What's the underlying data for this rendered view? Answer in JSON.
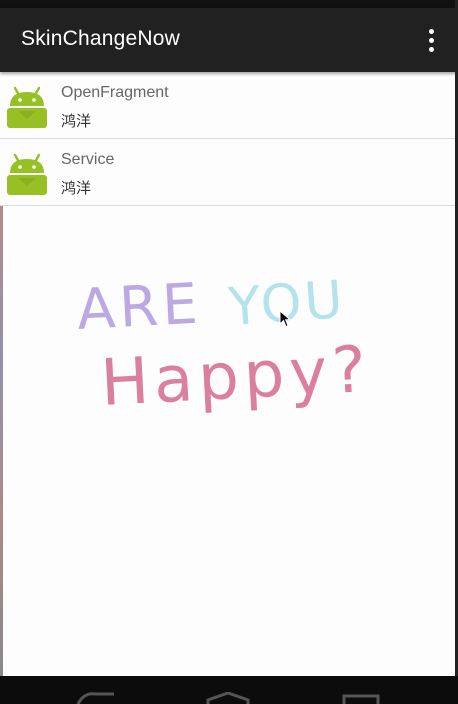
{
  "app": {
    "title": "SkinChangeNow"
  },
  "list": [
    {
      "title": "OpenFragment",
      "subtitle": "鸿洋"
    },
    {
      "title": "Service",
      "subtitle": "鸿洋"
    }
  ],
  "illustration": {
    "line1_word1": "ARE",
    "line1_word2": "YOU",
    "line2": "Happy?"
  },
  "colors": {
    "actionbar": "#212121",
    "android": "#97c024",
    "are": "#a58cd8",
    "you": "#9ad9e8",
    "happy": "#d0547e"
  },
  "icons": {
    "overflow": "more-vert-icon",
    "back": "back-icon",
    "home": "home-icon",
    "recents": "recents-icon"
  }
}
